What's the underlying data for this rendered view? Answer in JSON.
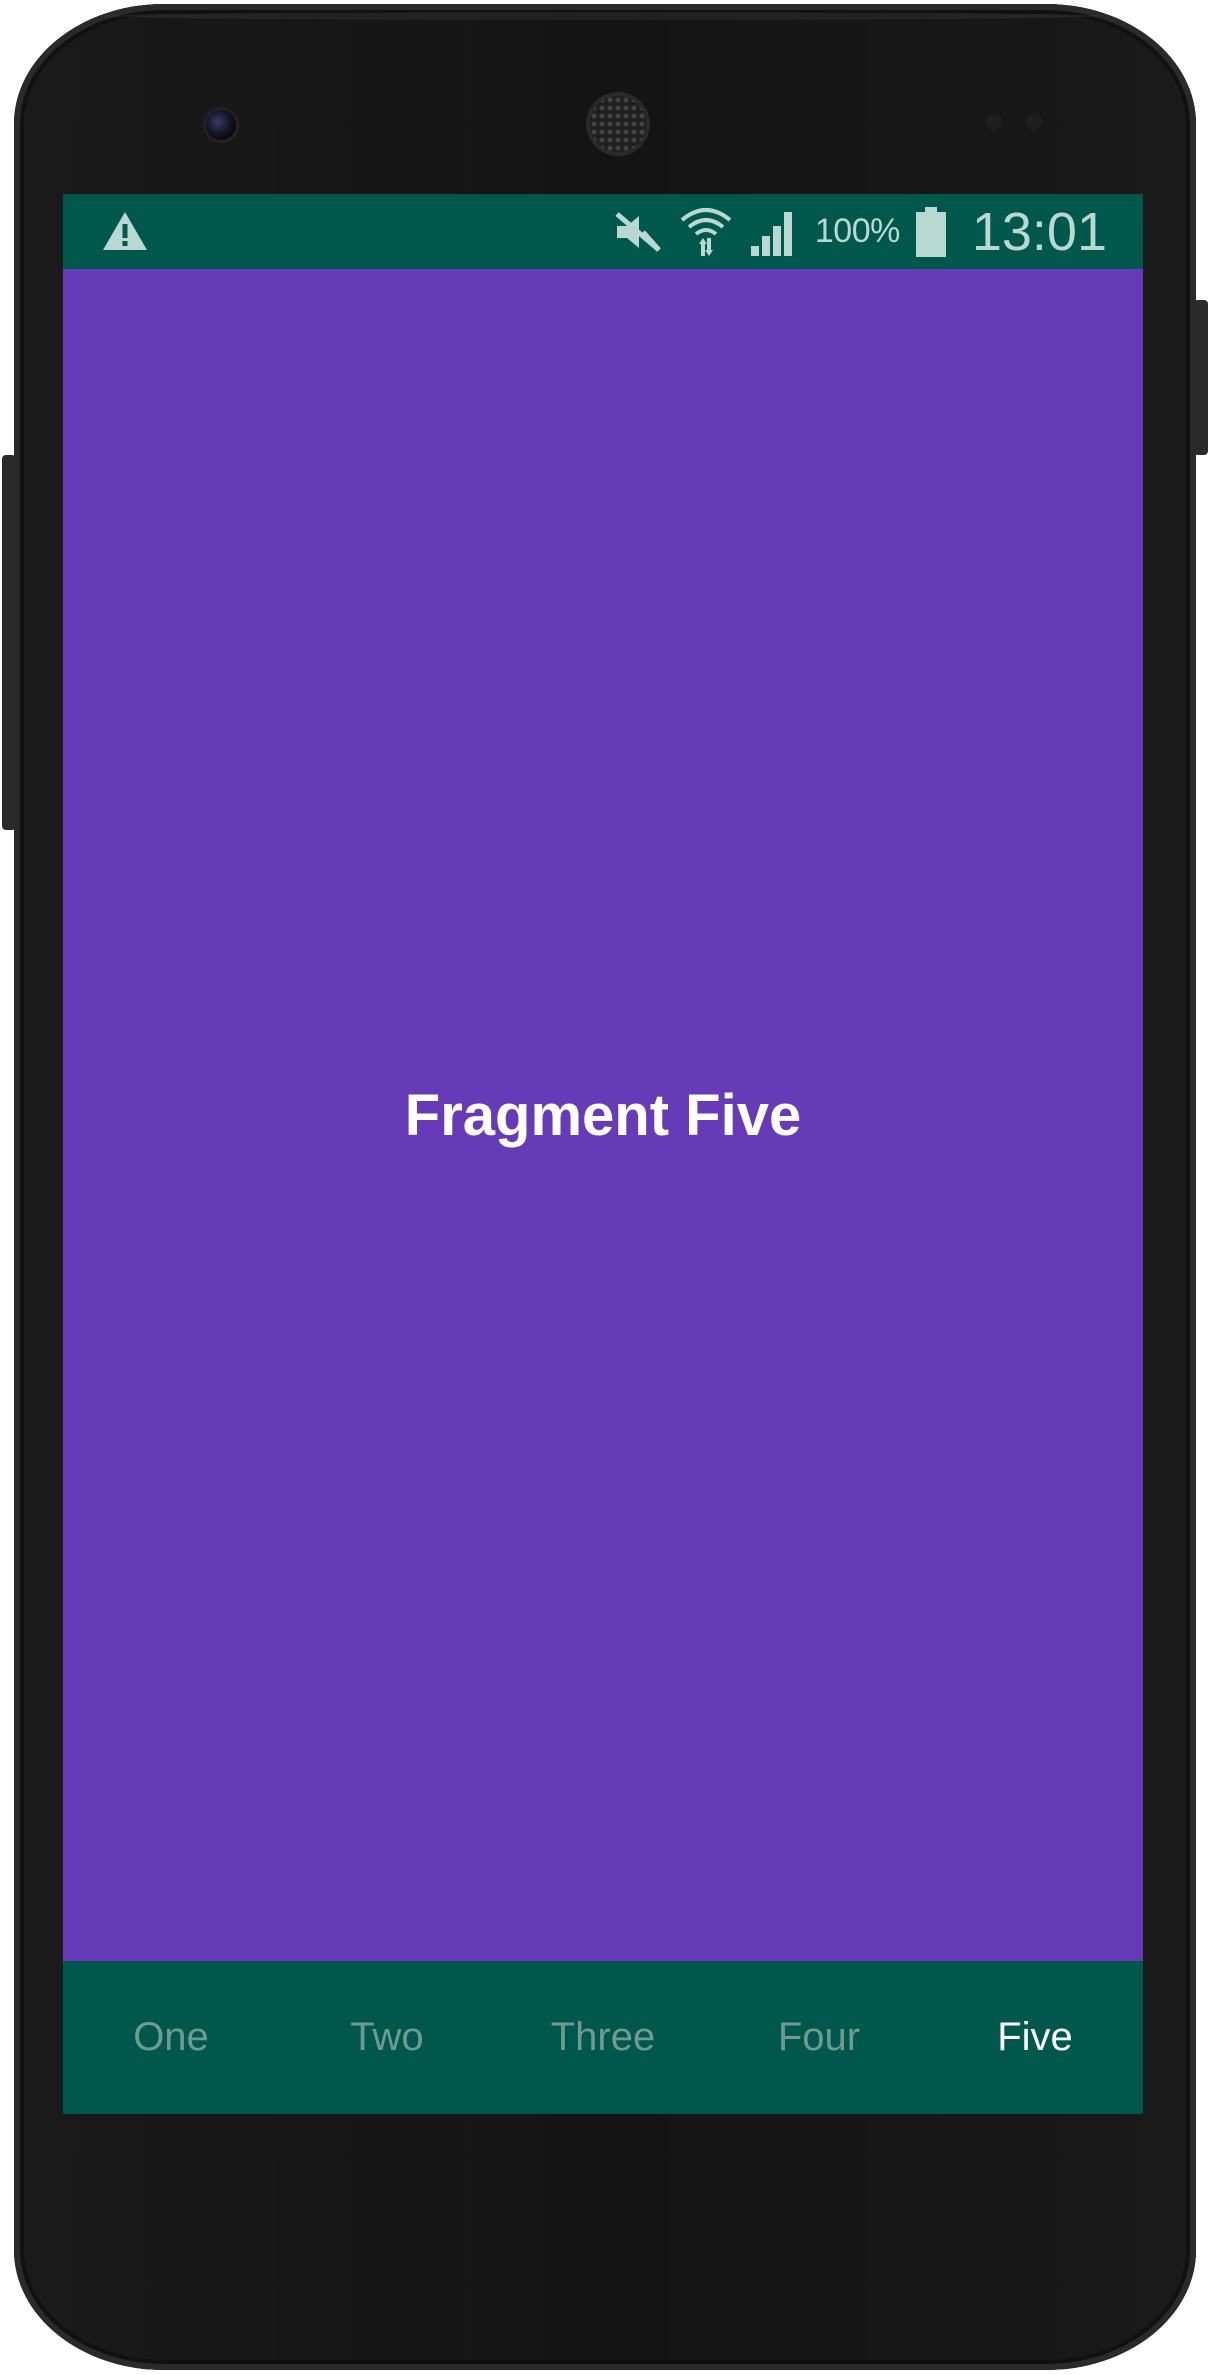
{
  "status_bar": {
    "warning_icon": "warning-icon",
    "mute_icon": "vibrate-off-icon",
    "wifi_icon": "wifi-icon",
    "signal_icon": "cell-signal-icon",
    "battery_percent": "100%",
    "battery_icon": "battery-full-icon",
    "time": "13:01",
    "background_color": "#00574b",
    "icon_color": "#b8d8d1"
  },
  "main": {
    "title": "Fragment Five",
    "background_color": "#673ab7"
  },
  "bottom_nav": {
    "items": [
      {
        "label": "One",
        "active": false
      },
      {
        "label": "Two",
        "active": false
      },
      {
        "label": "Three",
        "active": false
      },
      {
        "label": "Four",
        "active": false
      },
      {
        "label": "Five",
        "active": true
      }
    ],
    "background_color": "#00574b",
    "active_color": "#ffffff",
    "inactive_color": "#6f9a92"
  }
}
